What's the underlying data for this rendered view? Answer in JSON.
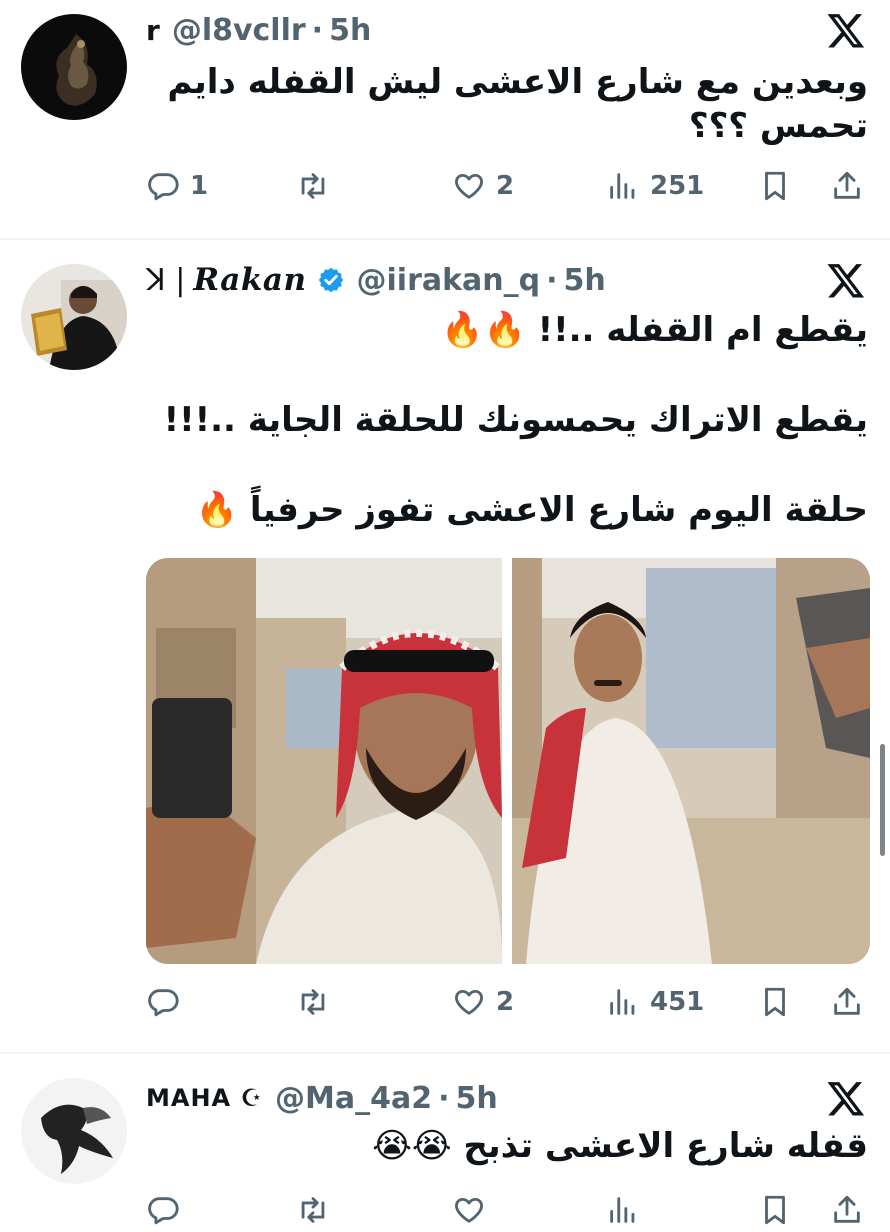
{
  "tweets": [
    {
      "name": "r",
      "handle": "@l8vcllr",
      "separator": "·",
      "time": "5h",
      "text_lines": [
        "وبعدين مع شارع الاعشى ليش القفله دايم",
        "تحمس ؟؟؟"
      ],
      "replies": "1",
      "retweets": "",
      "likes": "2",
      "views": "251"
    },
    {
      "name_prefix": "ꓘ |",
      "name": "Rakan",
      "verified": true,
      "handle": "@iirakan_q",
      "separator": "·",
      "time": "5h",
      "text_lines": [
        "يقطع ام القفله ..!! 🔥🔥",
        "يقطع الاتراك يحمسونك للحلقة الجاية ..!!!",
        "حلقة اليوم شارع الاعشى تفوز حرفياً 🔥"
      ],
      "replies": "",
      "retweets": "",
      "likes": "2",
      "views": "451"
    },
    {
      "name": "MAHA ☪︎",
      "handle": "@Ma_4a2",
      "separator": "·",
      "time": "5h",
      "text_lines": [
        "قفله شارع الاعشى تذبح 😭😭"
      ]
    }
  ],
  "icons": {
    "reply": "reply-icon",
    "retweet": "retweet-icon",
    "like": "heart-icon",
    "views": "views-icon",
    "bookmark": "bookmark-icon",
    "share": "share-icon",
    "x_logo": "x-logo-icon",
    "verified": "verified-badge-icon"
  },
  "colors": {
    "text": "#0f1419",
    "secondary": "#536471",
    "verified": "#1d9bf0",
    "divider": "#eff3f4"
  }
}
